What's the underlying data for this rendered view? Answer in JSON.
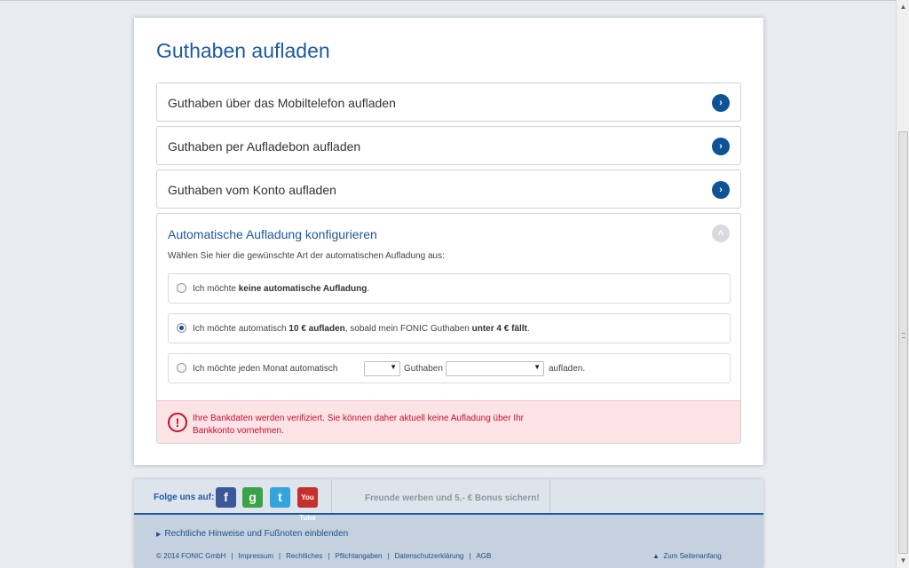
{
  "page": {
    "title": "Guthaben aufladen"
  },
  "accordion": {
    "items": [
      {
        "label": "Guthaben über das Mobiltelefon aufladen",
        "icon": "chevron-right-icon"
      },
      {
        "label": "Guthaben per Aufladebon aufladen",
        "icon": "chevron-right-icon"
      },
      {
        "label": "Guthaben vom Konto aufladen",
        "icon": "chevron-right-icon"
      }
    ],
    "open": {
      "label": "Automatische Aufladung konfigurieren",
      "icon": "chevron-up-icon",
      "description": "Wählen Sie hier die gewünschte Art der automatischen Aufladung aus:"
    }
  },
  "options": {
    "none": {
      "prefix": "Ich möchte ",
      "bold": "keine automatische Aufladung",
      "suffix": ".",
      "checked": false
    },
    "threshold": {
      "prefix": "Ich möchte automatisch ",
      "bold1": "10 € aufladen",
      "middle": ", sobald mein FONIC Guthaben ",
      "bold2": "unter 4 € fällt",
      "suffix": ".",
      "checked": true
    },
    "monthly": {
      "prefix": "Ich möchte jeden Monat automatisch",
      "day_value": "",
      "guthaben_label": "Guthaben",
      "amount_value": "",
      "suffix": "aufladen.",
      "checked": false
    }
  },
  "alert": {
    "icon": "exclamation-circle-icon",
    "text": "Ihre Bankdaten werden verifiziert. Sie können daher aktuell keine Aufladung über Ihr Bankkonto vornehmen."
  },
  "footer": {
    "follow_label": "Folge uns auf:",
    "social": [
      {
        "name": "facebook-icon",
        "glyph": "f"
      },
      {
        "name": "google-plus-icon",
        "glyph": "g"
      },
      {
        "name": "twitter-icon",
        "glyph": "t"
      },
      {
        "name": "youtube-icon",
        "glyph": "You Tube"
      }
    ],
    "promo": "Freunde werben und 5,- € Bonus sichern!",
    "legal_toggle": "Rechtliche Hinweise und Fußnoten einblenden",
    "copyright": "© 2014 FONIC GmbH",
    "links": [
      "Impressum",
      "Rechtliches",
      "Pflichtangaben",
      "Datenschutzerklärung",
      "AGB"
    ],
    "to_top": "Zum Seitenanfang"
  },
  "colors": {
    "brand_blue": "#1d5aa0",
    "button_blue": "#0e5396",
    "error_red": "#c8102e",
    "error_bg": "#fbe3e6"
  }
}
